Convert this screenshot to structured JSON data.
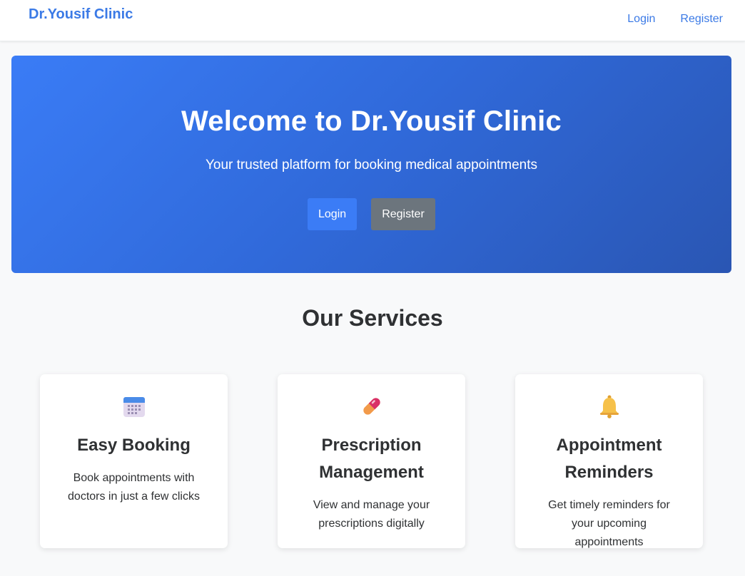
{
  "navbar": {
    "brand": "Dr.Yousif Clinic",
    "links": [
      "Login",
      "Register"
    ]
  },
  "hero": {
    "title": "Welcome to Dr.Yousif Clinic",
    "subtitle": "Your trusted platform for booking medical appointments",
    "buttons": {
      "login": "Login",
      "register": "Register"
    }
  },
  "services": {
    "title": "Our Services",
    "cards": [
      {
        "icon": "calendar-icon",
        "title": "Easy Booking",
        "description": "Book appointments with doctors in just a few clicks"
      },
      {
        "icon": "pill-icon",
        "title": "Prescription Management",
        "description": "View and manage your prescriptions digitally"
      },
      {
        "icon": "bell-icon",
        "title": "Appointment Reminders",
        "description": "Get timely reminders for your upcoming appointments"
      }
    ]
  },
  "colors": {
    "brand": "#3b7ae6",
    "hero_gradient_start": "#3a7cf6",
    "hero_gradient_end": "#2a56b3",
    "primary_button": "#3b7cf6",
    "secondary_button": "#6c757d"
  }
}
